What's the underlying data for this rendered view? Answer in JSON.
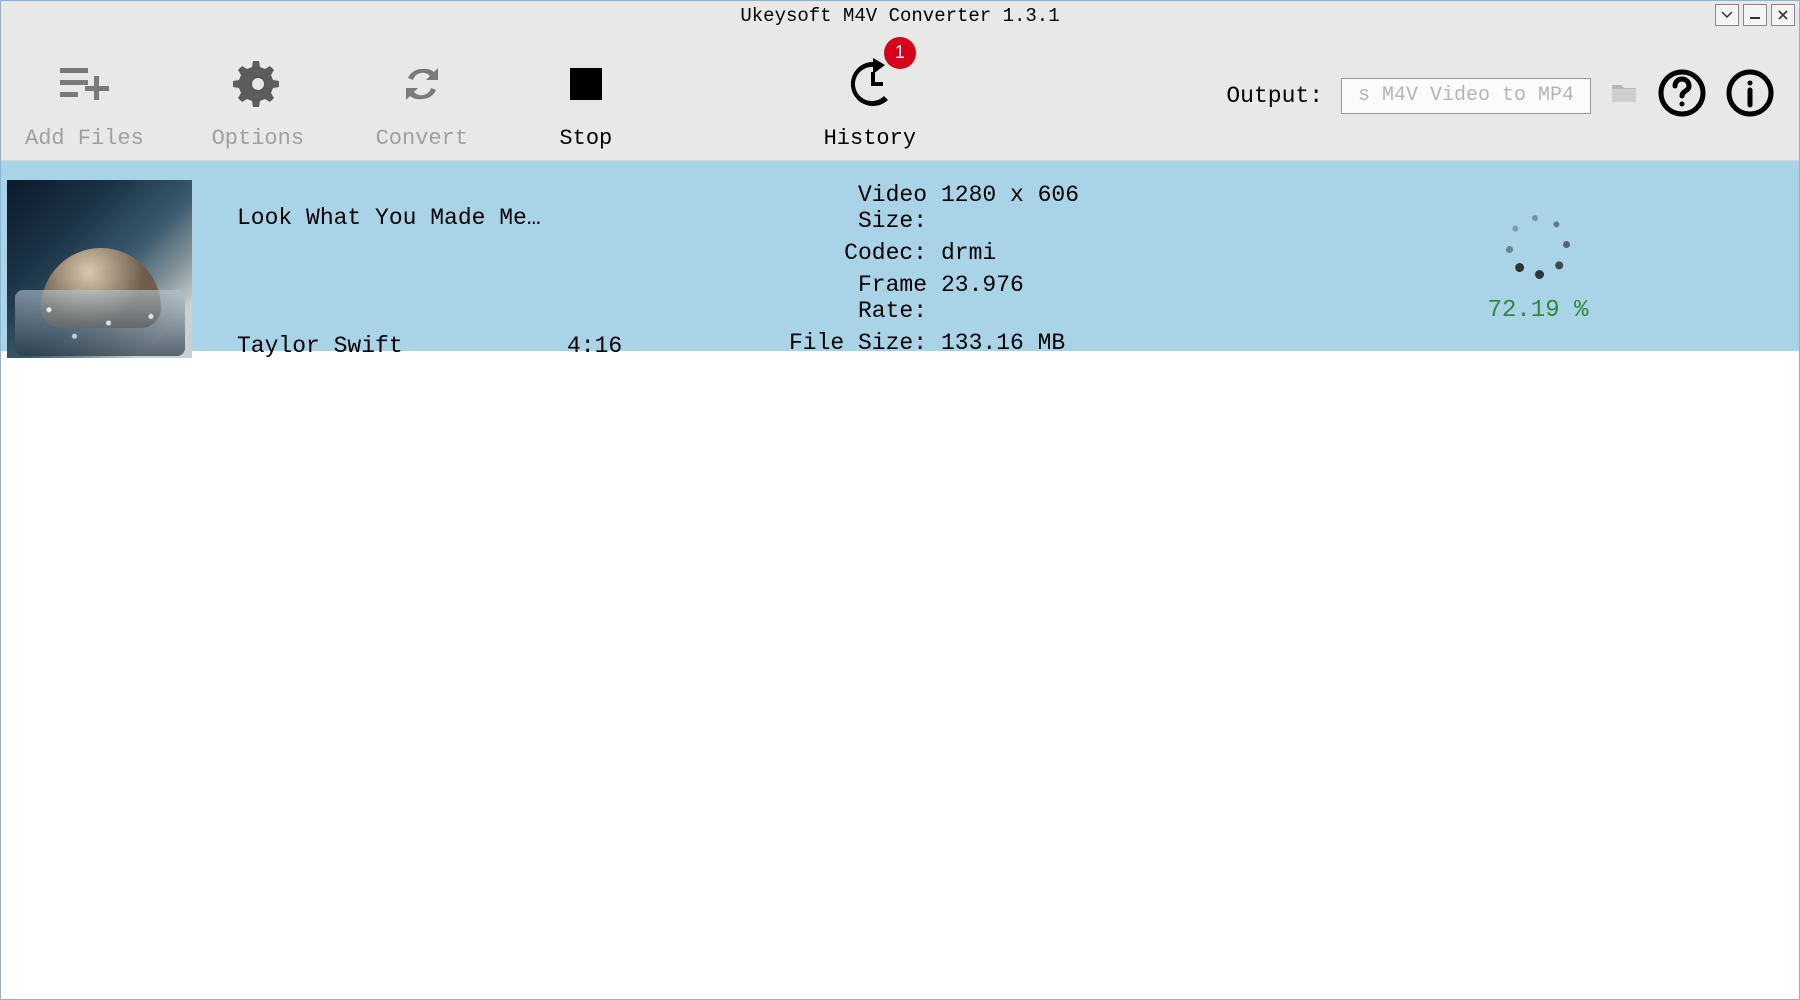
{
  "app": {
    "title": "Ukeysoft M4V Converter 1.3.1"
  },
  "toolbar": {
    "add_files": "Add Files",
    "options": "Options",
    "convert": "Convert",
    "stop": "Stop",
    "history": "History",
    "history_badge": "1",
    "output_label": "Output:",
    "output_value": "s M4V Video to MP4"
  },
  "list": [
    {
      "title": "Look What You Made Me…",
      "artist": "Taylor Swift",
      "duration": "4:16",
      "meta": {
        "video_size_label": "Video Size:",
        "video_size": "1280 x 606",
        "codec_label": "Codec:",
        "codec": "drmi",
        "frame_rate_label": "Frame Rate:",
        "frame_rate": "23.976",
        "file_size_label": "File Size:",
        "file_size": "133.16 MB"
      },
      "progress": "72.19 %"
    }
  ]
}
